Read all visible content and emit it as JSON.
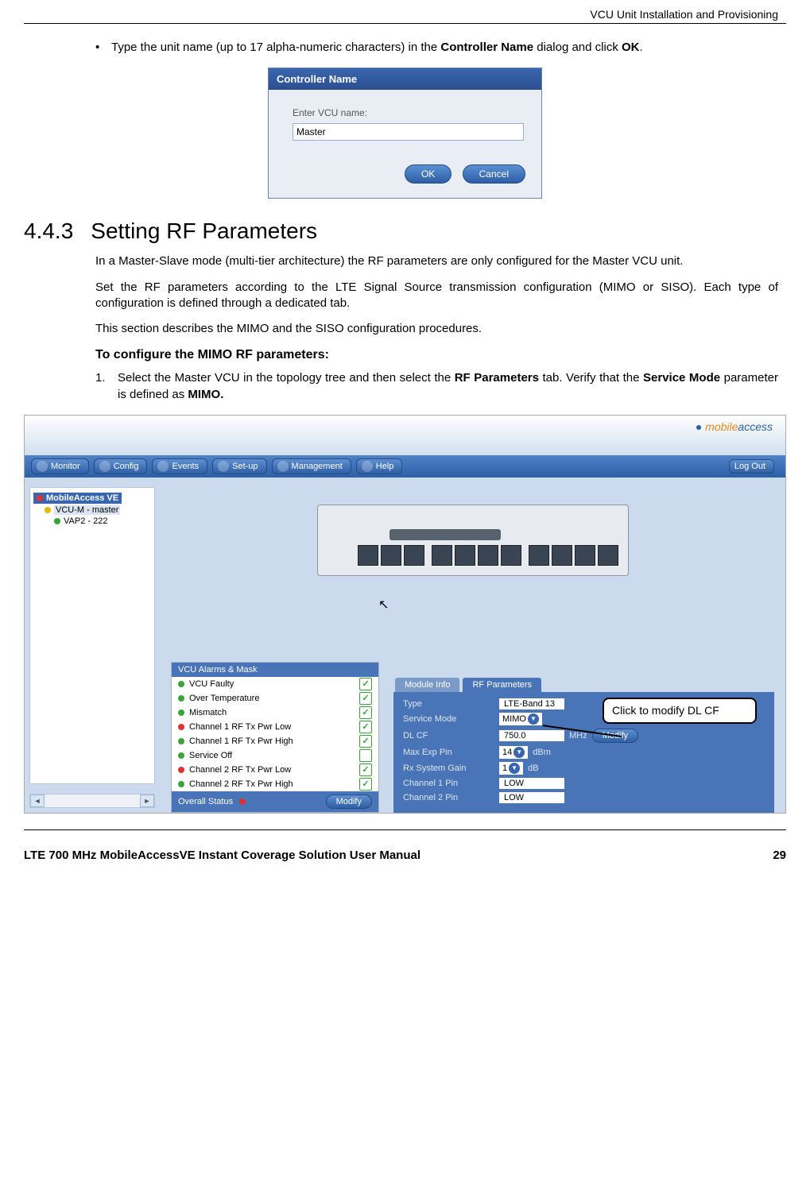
{
  "header": {
    "section": "VCU Unit Installation and Provisioning"
  },
  "bullet1": {
    "pre": "Type the unit name (up to 17 alpha-numeric characters) in the ",
    "bold1": "Controller Name",
    "mid": " dialog and click ",
    "bold2": "OK",
    "post": "."
  },
  "dialog": {
    "title": "Controller Name",
    "label": "Enter VCU name:",
    "value": "Master",
    "ok": "OK",
    "cancel": "Cancel"
  },
  "sec": {
    "num": "4.4.3",
    "title": "Setting RF Parameters"
  },
  "p1": "In a Master-Slave mode (multi-tier architecture) the RF parameters are only configured for the Master VCU unit.",
  "p2": "Set the RF parameters according to the LTE Signal Source transmission configuration (MIMO or SISO). Each type of configuration is defined through a dedicated tab.",
  "p3": "This section describes the MIMO and the SISO configuration procedures.",
  "sub": "To configure the MIMO RF parameters:",
  "step1": {
    "n": "1.",
    "pre": "Select the Master VCU in the topology tree and then select the ",
    "b1": "RF Parameters",
    "mid": " tab. Verify that the ",
    "b2": "Service Mode",
    "mid2": " parameter is defined as ",
    "b3": "MIMO."
  },
  "app": {
    "logo_brand": "mobile",
    "logo_accent": "access",
    "nav": [
      "Monitor",
      "Config",
      "Events",
      "Set-up",
      "Management",
      "Help"
    ],
    "logout": "Log Out",
    "tree": {
      "root": "MobileAccess VE",
      "node1": "VCU-M - master",
      "node2": "VAP2 - 222"
    },
    "alarms_title": "VCU Alarms & Mask",
    "alarms": [
      {
        "dot": "g",
        "name": "VCU Faulty",
        "chk": true
      },
      {
        "dot": "g",
        "name": "Over Temperature",
        "chk": true
      },
      {
        "dot": "g",
        "name": "Mismatch",
        "chk": true
      },
      {
        "dot": "r",
        "name": "Channel 1 RF Tx Pwr Low",
        "chk": true
      },
      {
        "dot": "g",
        "name": "Channel 1 RF Tx Pwr High",
        "chk": true
      },
      {
        "dot": "g",
        "name": "Service Off",
        "chk": false
      },
      {
        "dot": "r",
        "name": "Channel 2 RF Tx Pwr Low",
        "chk": true
      },
      {
        "dot": "g",
        "name": "Channel 2 RF Tx Pwr High",
        "chk": true
      }
    ],
    "overall_label": "Overall Status",
    "modify": "Modify",
    "tabs": {
      "info": "Module Info",
      "rf": "RF Parameters"
    },
    "params": {
      "type_lbl": "Type",
      "type_val": "LTE-Band 13",
      "mode_lbl": "Service Mode",
      "mode_val": "MIMO",
      "dlcf_lbl": "DL CF",
      "dlcf_val": "750.0",
      "dlcf_unit": "MHz",
      "max_lbl": "Max Exp Pin",
      "max_val": "14",
      "max_unit": "dBm",
      "rx_lbl": "Rx System Gain",
      "rx_val": "1",
      "rx_unit": "dB",
      "c1_lbl": "Channel 1 Pin",
      "c1_val": "LOW",
      "c2_lbl": "Channel 2 Pin",
      "c2_val": "LOW"
    },
    "callout": "Click to modify DL CF"
  },
  "footer": {
    "manual": "LTE 700 MHz MobileAccessVE Instant Coverage Solution User Manual",
    "page": "29"
  }
}
